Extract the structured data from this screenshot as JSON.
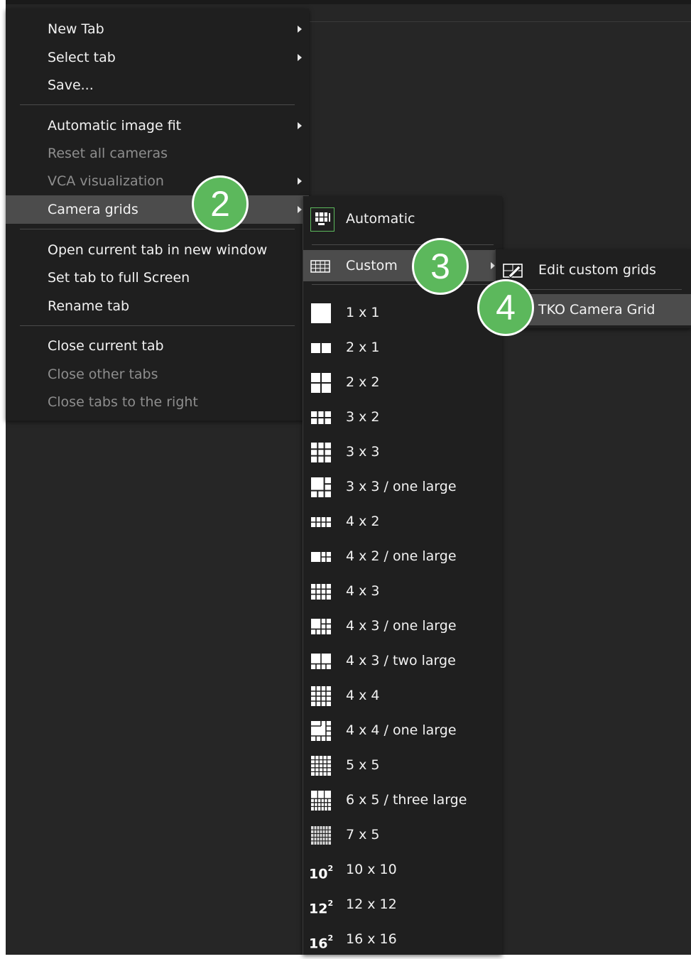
{
  "main_menu": {
    "items": [
      {
        "label": "New Tab",
        "has_submenu": true,
        "disabled": false
      },
      {
        "label": "Select tab",
        "has_submenu": true,
        "disabled": false
      },
      {
        "label": "Save...",
        "has_submenu": false,
        "disabled": false
      },
      {
        "label": "Automatic image fit",
        "has_submenu": true,
        "disabled": false
      },
      {
        "label": "Reset all cameras",
        "has_submenu": false,
        "disabled": true
      },
      {
        "label": "VCA visualization",
        "has_submenu": true,
        "disabled": true
      },
      {
        "label": "Camera grids",
        "has_submenu": true,
        "disabled": false,
        "highlighted": true
      },
      {
        "label": "Open current tab in new window",
        "has_submenu": false,
        "disabled": false
      },
      {
        "label": "Set tab to full Screen",
        "has_submenu": false,
        "disabled": false
      },
      {
        "label": "Rename tab",
        "has_submenu": false,
        "disabled": false
      },
      {
        "label": "Close current tab",
        "has_submenu": false,
        "disabled": false
      },
      {
        "label": "Close other tabs",
        "has_submenu": false,
        "disabled": true
      },
      {
        "label": "Close tabs to the right",
        "has_submenu": false,
        "disabled": true
      }
    ]
  },
  "grids_menu": {
    "automatic": {
      "label": "Automatic",
      "icon": "automatic-grid-icon"
    },
    "custom": {
      "label": "Custom",
      "icon": "custom-grid-icon",
      "has_submenu": true,
      "highlighted": true
    },
    "items": [
      {
        "label": "1 x 1",
        "icon": "grid-1x1-icon"
      },
      {
        "label": "2 x 1",
        "icon": "grid-2x1-icon"
      },
      {
        "label": "2 x 2",
        "icon": "grid-2x2-icon"
      },
      {
        "label": "3 x 2",
        "icon": "grid-3x2-icon"
      },
      {
        "label": "3 x 3",
        "icon": "grid-3x3-icon"
      },
      {
        "label": "3 x 3 / one large",
        "icon": "grid-3x3-one-large-icon"
      },
      {
        "label": "4 x 2",
        "icon": "grid-4x2-icon"
      },
      {
        "label": "4 x 2 / one large",
        "icon": "grid-4x2-one-large-icon"
      },
      {
        "label": "4 x 3",
        "icon": "grid-4x3-icon"
      },
      {
        "label": "4 x 3 / one large",
        "icon": "grid-4x3-one-large-icon"
      },
      {
        "label": "4 x 3 / two large",
        "icon": "grid-4x3-two-large-icon"
      },
      {
        "label": "4 x 4",
        "icon": "grid-4x4-icon"
      },
      {
        "label": "4 x 4 / one large",
        "icon": "grid-4x4-one-large-icon"
      },
      {
        "label": "5 x 5",
        "icon": "grid-5x5-icon"
      },
      {
        "label": "6 x 5 / three large",
        "icon": "grid-6x5-three-large-icon"
      },
      {
        "label": "7 x 5",
        "icon": "grid-7x5-icon"
      },
      {
        "label": "10 x 10",
        "icon_text": "10",
        "icon_sup": "2"
      },
      {
        "label": "12 x 12",
        "icon_text": "12",
        "icon_sup": "2"
      },
      {
        "label": "16 x 16",
        "icon_text": "16",
        "icon_sup": "2"
      }
    ]
  },
  "custom_menu": {
    "items": [
      {
        "label": "Edit custom grids",
        "icon": "edit-grid-icon"
      },
      {
        "label": "TKO Camera Grid",
        "highlighted": true
      }
    ]
  },
  "badges": [
    "2",
    "3",
    "4"
  ],
  "colors": {
    "badge": "#5cb85c",
    "menu_bg": "#1f1f1f",
    "highlight": "#4c4c4c",
    "disabled_text": "#8e8e8e"
  }
}
